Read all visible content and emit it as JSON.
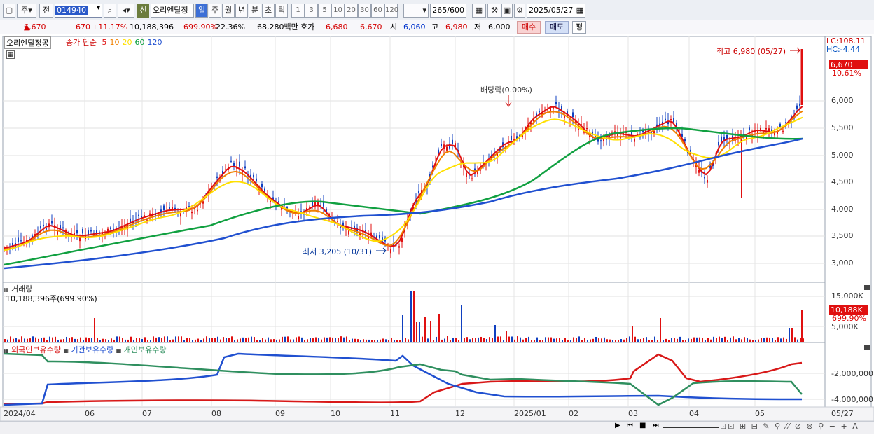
{
  "toolbar": {
    "period_label": "주",
    "prev_label": "전",
    "code": "014940",
    "name": "오리엔탈정",
    "new_badge": "신",
    "tabs": [
      "일",
      "주",
      "월",
      "년",
      "분",
      "초",
      "틱"
    ],
    "intervals": [
      "1",
      "3",
      "5",
      "10",
      "20",
      "30",
      "60",
      "120"
    ],
    "count": "265",
    "max": "/600",
    "date": "2025/05/27"
  },
  "quote": {
    "price": "6,670",
    "change": "670",
    "change_pct": "+11.17%",
    "volume": "10,188,396",
    "vol_ratio": "699.90%",
    "turnover": "22.36%",
    "amount": "68,280백만",
    "hoga_label": "호가",
    "hoga": "6,680",
    "hoga2": "6,670",
    "open_label": "시",
    "open": "6,060",
    "high_label": "고",
    "high": "6,980",
    "low_label": "저",
    "low": "6,000",
    "buy": "매수",
    "sell": "매도",
    "extra": "평"
  },
  "price_chart": {
    "name_label": "오리엔탈정공",
    "legend_prefix": "종가 단순",
    "ma": [
      "5",
      "10",
      "20",
      "60",
      "120"
    ],
    "ma_colors": [
      "#e01010",
      "#f08000",
      "#ffe000",
      "#10a040",
      "#2050d0"
    ],
    "lc": "LC:108.11",
    "hc": "HC:-4.44",
    "current_price": "6,670",
    "current_pct": "10.61%",
    "high_marker": "최고 6,980 (05/27)",
    "low_marker": "최저 3,205 (10/31)",
    "dividend": "배당락(0.00%)",
    "yticks": [
      "6,000",
      "5,500",
      "5,000",
      "4,500",
      "4,000",
      "3,500",
      "3,000"
    ]
  },
  "volume_chart": {
    "title": "거래량",
    "info": "10,188,396주(699.90%)",
    "current": "10,188K",
    "current_pct": "699.90%",
    "yticks": [
      "15,000K",
      "5,000K"
    ]
  },
  "holding_chart": {
    "series": [
      "외국인보유수량",
      "기관보유수량",
      "개인보유수량"
    ],
    "colors": [
      "#d81818",
      "#2050d0",
      "#2f8f5f"
    ],
    "yticks": [
      "-2,000,000",
      "-4,000,000"
    ]
  },
  "xaxis": [
    "2024/04",
    "06",
    "07",
    "08",
    "09",
    "10",
    "11",
    "12",
    "2025/01",
    "02",
    "03",
    "04",
    "05",
    "05/27"
  ]
}
